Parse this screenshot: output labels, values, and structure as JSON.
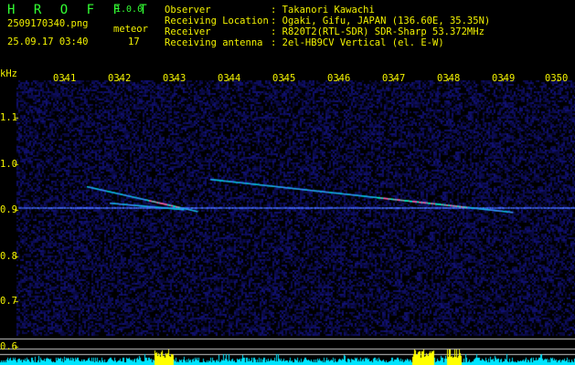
{
  "app": {
    "name": "H R O F F T",
    "version": "1.0.0"
  },
  "file": {
    "name": "2509170340.png",
    "datetime": "25.09.17 03:40"
  },
  "meteor": {
    "label": "meteor",
    "count": "17"
  },
  "info": {
    "observer_label": "Observer",
    "observer_value": ": Takanori Kawachi",
    "location_label": "Receiving Location",
    "location_value": ": Ogaki, Gifu, JAPAN (136.60E, 35.35N)",
    "receiver_label": "Receiver",
    "receiver_value": ": R820T2(RTL-SDR) SDR-Sharp 53.372MHz",
    "antenna_label": "Receiving antenna",
    "antenna_value": ": 2el-HB9CV Vertical (el. E-W)"
  },
  "axis": {
    "y_unit": "kHz",
    "x_ticks": [
      "0341",
      "0342",
      "0343",
      "0344",
      "0345",
      "0346",
      "0347",
      "0348",
      "0349",
      "0350"
    ],
    "y_ticks": [
      "1.1",
      "1.0",
      "0.9",
      "0.8",
      "0.7",
      "0.6"
    ]
  },
  "colors": {
    "text": "#f2f200",
    "brand": "#33ff33",
    "background": "#000000",
    "noise": "#0a0a5a",
    "carrier": "#3a6cff",
    "meteor": "#00ffd0",
    "bar_cyan": "#00e5ff",
    "bar_yellow": "#ffff00"
  }
}
